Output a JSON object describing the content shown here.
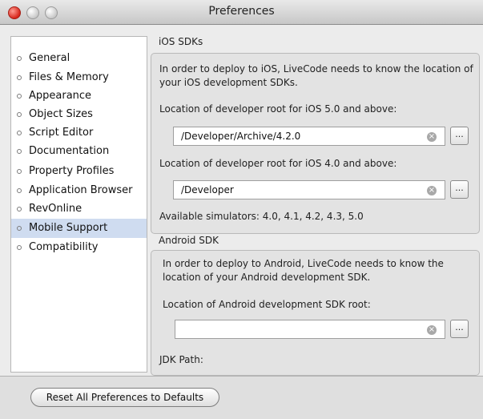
{
  "window": {
    "title": "Preferences"
  },
  "sidebar": {
    "items": [
      {
        "label": "General",
        "selected": false
      },
      {
        "label": "Files & Memory",
        "selected": false
      },
      {
        "label": "Appearance",
        "selected": false
      },
      {
        "label": "Object Sizes",
        "selected": false
      },
      {
        "label": "Script Editor",
        "selected": false
      },
      {
        "label": "Documentation",
        "selected": false
      },
      {
        "label": "Property Profiles",
        "selected": false
      },
      {
        "label": "Application Browser",
        "selected": false
      },
      {
        "label": "RevOnline",
        "selected": false
      },
      {
        "label": "Mobile Support",
        "selected": true
      },
      {
        "label": "Compatibility",
        "selected": false
      }
    ]
  },
  "ios": {
    "section_title": "iOS SDKs",
    "description": "In order to deploy to iOS, LiveCode needs to know the location of your iOS development SDKs.",
    "root5_label": "Location of developer root for iOS 5.0 and above:",
    "root5_value": "/Developer/Archive/4.2.0",
    "root4_label": "Location of developer root for iOS 4.0 and above:",
    "root4_value": "/Developer",
    "simulators_label": "Available simulators: 4.0, 4.1, 4.2, 4.3, 5.0"
  },
  "android": {
    "section_title": "Android SDK",
    "description": "In order to deploy to Android, LiveCode needs to know the location of your Android development SDK.",
    "sdk_label": "Location of Android development SDK root:",
    "sdk_value": "",
    "jdk_label": "JDK Path:"
  },
  "buttons": {
    "browse_label": "...",
    "reset_label": "Reset All Preferences to Defaults"
  },
  "icons": {
    "clear_glyph": "×"
  }
}
